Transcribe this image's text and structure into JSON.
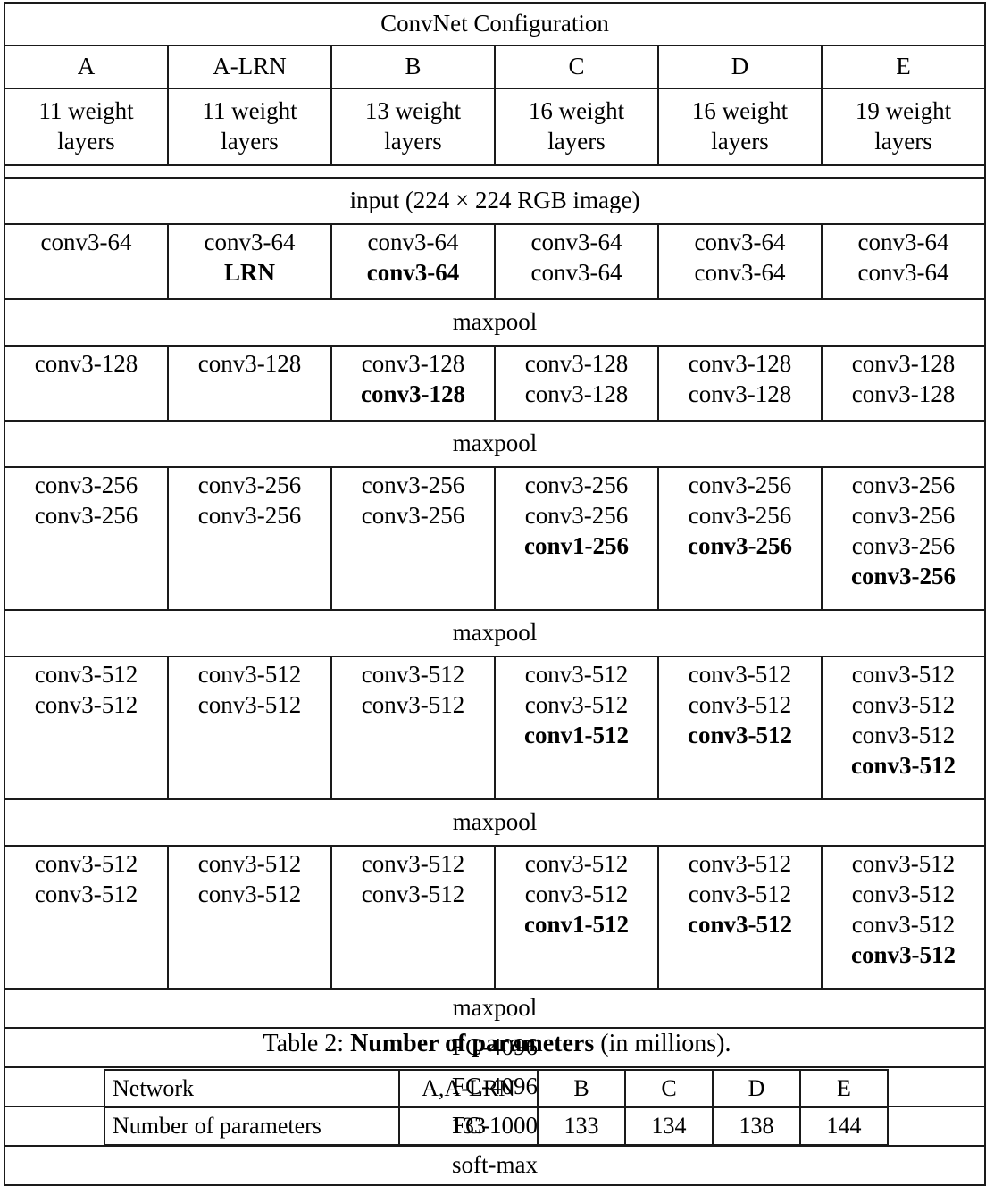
{
  "table1": {
    "title": "ConvNet Configuration",
    "columns": [
      "A",
      "A-LRN",
      "B",
      "C",
      "D",
      "E"
    ],
    "depths": [
      "11 weight layers",
      "11 weight layers",
      "13 weight layers",
      "16 weight layers",
      "16 weight layers",
      "19 weight layers"
    ],
    "input_row": "input (224 × 224 RGB image)",
    "maxpool": "maxpool",
    "blocks": [
      {
        "id": "conv64",
        "cells": [
          [
            {
              "t": "conv3-64",
              "bold": false
            }
          ],
          [
            {
              "t": "conv3-64",
              "bold": false
            },
            {
              "t": "LRN",
              "bold": true
            }
          ],
          [
            {
              "t": "conv3-64",
              "bold": false
            },
            {
              "t": "conv3-64",
              "bold": true
            }
          ],
          [
            {
              "t": "conv3-64",
              "bold": false
            },
            {
              "t": "conv3-64",
              "bold": false
            }
          ],
          [
            {
              "t": "conv3-64",
              "bold": false
            },
            {
              "t": "conv3-64",
              "bold": false
            }
          ],
          [
            {
              "t": "conv3-64",
              "bold": false
            },
            {
              "t": "conv3-64",
              "bold": false
            }
          ]
        ]
      },
      {
        "id": "conv128",
        "cells": [
          [
            {
              "t": "conv3-128",
              "bold": false
            }
          ],
          [
            {
              "t": "conv3-128",
              "bold": false
            }
          ],
          [
            {
              "t": "conv3-128",
              "bold": false
            },
            {
              "t": "conv3-128",
              "bold": true
            }
          ],
          [
            {
              "t": "conv3-128",
              "bold": false
            },
            {
              "t": "conv3-128",
              "bold": false
            }
          ],
          [
            {
              "t": "conv3-128",
              "bold": false
            },
            {
              "t": "conv3-128",
              "bold": false
            }
          ],
          [
            {
              "t": "conv3-128",
              "bold": false
            },
            {
              "t": "conv3-128",
              "bold": false
            }
          ]
        ]
      },
      {
        "id": "conv256",
        "cells": [
          [
            {
              "t": "conv3-256",
              "bold": false
            },
            {
              "t": "conv3-256",
              "bold": false
            }
          ],
          [
            {
              "t": "conv3-256",
              "bold": false
            },
            {
              "t": "conv3-256",
              "bold": false
            }
          ],
          [
            {
              "t": "conv3-256",
              "bold": false
            },
            {
              "t": "conv3-256",
              "bold": false
            }
          ],
          [
            {
              "t": "conv3-256",
              "bold": false
            },
            {
              "t": "conv3-256",
              "bold": false
            },
            {
              "t": "conv1-256",
              "bold": true
            }
          ],
          [
            {
              "t": "conv3-256",
              "bold": false
            },
            {
              "t": "conv3-256",
              "bold": false
            },
            {
              "t": "conv3-256",
              "bold": true
            }
          ],
          [
            {
              "t": "conv3-256",
              "bold": false
            },
            {
              "t": "conv3-256",
              "bold": false
            },
            {
              "t": "conv3-256",
              "bold": false
            },
            {
              "t": "conv3-256",
              "bold": true
            }
          ]
        ]
      },
      {
        "id": "conv512a",
        "cells": [
          [
            {
              "t": "conv3-512",
              "bold": false
            },
            {
              "t": "conv3-512",
              "bold": false
            }
          ],
          [
            {
              "t": "conv3-512",
              "bold": false
            },
            {
              "t": "conv3-512",
              "bold": false
            }
          ],
          [
            {
              "t": "conv3-512",
              "bold": false
            },
            {
              "t": "conv3-512",
              "bold": false
            }
          ],
          [
            {
              "t": "conv3-512",
              "bold": false
            },
            {
              "t": "conv3-512",
              "bold": false
            },
            {
              "t": "conv1-512",
              "bold": true
            }
          ],
          [
            {
              "t": "conv3-512",
              "bold": false
            },
            {
              "t": "conv3-512",
              "bold": false
            },
            {
              "t": "conv3-512",
              "bold": true
            }
          ],
          [
            {
              "t": "conv3-512",
              "bold": false
            },
            {
              "t": "conv3-512",
              "bold": false
            },
            {
              "t": "conv3-512",
              "bold": false
            },
            {
              "t": "conv3-512",
              "bold": true
            }
          ]
        ]
      },
      {
        "id": "conv512b",
        "cells": [
          [
            {
              "t": "conv3-512",
              "bold": false
            },
            {
              "t": "conv3-512",
              "bold": false
            }
          ],
          [
            {
              "t": "conv3-512",
              "bold": false
            },
            {
              "t": "conv3-512",
              "bold": false
            }
          ],
          [
            {
              "t": "conv3-512",
              "bold": false
            },
            {
              "t": "conv3-512",
              "bold": false
            }
          ],
          [
            {
              "t": "conv3-512",
              "bold": false
            },
            {
              "t": "conv3-512",
              "bold": false
            },
            {
              "t": "conv1-512",
              "bold": true
            }
          ],
          [
            {
              "t": "conv3-512",
              "bold": false
            },
            {
              "t": "conv3-512",
              "bold": false
            },
            {
              "t": "conv3-512",
              "bold": true
            }
          ],
          [
            {
              "t": "conv3-512",
              "bold": false
            },
            {
              "t": "conv3-512",
              "bold": false
            },
            {
              "t": "conv3-512",
              "bold": false
            },
            {
              "t": "conv3-512",
              "bold": true
            }
          ]
        ]
      }
    ],
    "tail_rows": [
      "maxpool",
      "FC-4096",
      "FC-4096",
      "FC-1000",
      "soft-max"
    ]
  },
  "table2": {
    "caption_prefix": "Table 2: ",
    "caption_bold": "Number of parameters",
    "caption_suffix": " (in millions).",
    "row_labels": [
      "Network",
      "Number of parameters"
    ],
    "networks": [
      "A,A-LRN",
      "B",
      "C",
      "D",
      "E"
    ],
    "values": [
      "133",
      "133",
      "134",
      "138",
      "144"
    ]
  }
}
